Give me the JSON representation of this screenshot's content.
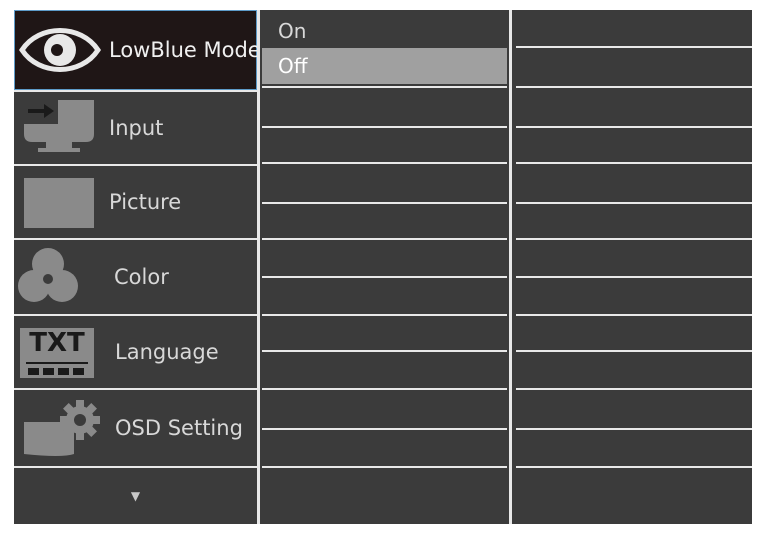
{
  "osd": {
    "menu": {
      "items": [
        {
          "label": "LowBlue Mode",
          "icon": "eye-icon",
          "selected": true
        },
        {
          "label": "Input",
          "icon": "input-arrow-icon",
          "selected": false
        },
        {
          "label": "Picture",
          "icon": "picture-icon",
          "selected": false
        },
        {
          "label": "Color",
          "icon": "color-icon",
          "selected": false
        },
        {
          "label": "Language",
          "icon": "language-icon",
          "selected": false
        },
        {
          "label": "OSD Setting",
          "icon": "gear-icon",
          "selected": false
        }
      ],
      "more_glyph": "▼",
      "more_icon": "chevron-down-icon"
    },
    "submenu": {
      "options": [
        {
          "label": "On",
          "selected": false
        },
        {
          "label": "Off",
          "selected": true
        }
      ]
    },
    "language_icon_text": "TXT"
  },
  "colors": {
    "background": "#3b3b3b",
    "selected_menu_bg": "#1f1616",
    "selected_menu_border": "#5d9bc9",
    "selected_option_bg": "#a0a0a0",
    "separator": "#e8e8e8",
    "text": "#d8d8d8"
  }
}
